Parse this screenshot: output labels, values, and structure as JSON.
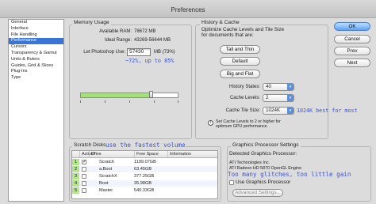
{
  "window": {
    "title": "Preferences"
  },
  "sidebar": {
    "items": [
      {
        "label": "General"
      },
      {
        "label": "Interface"
      },
      {
        "label": "File Handling"
      },
      {
        "label": "Performance"
      },
      {
        "label": "Cursors"
      },
      {
        "label": "Transparency & Gamut"
      },
      {
        "label": "Units & Rulers"
      },
      {
        "label": "Guides, Grid & Slices"
      },
      {
        "label": "Plug-Ins"
      },
      {
        "label": "Type"
      }
    ],
    "selected": "Performance"
  },
  "memory": {
    "title": "Memory Usage",
    "available_label": "Available RAM:",
    "available_value": "78672 MB",
    "ideal_label": "Ideal Range:",
    "ideal_value": "43269-56644 MB",
    "let_label": "Let Photoshop Use:",
    "let_value": "57430",
    "let_unit": "MB (73%)",
    "slider_level": 0.73,
    "annotation": "~72%, up to 85%"
  },
  "history": {
    "title": "History & Cache",
    "desc": "Optimize Cache Levels and Tile Size for documents that are:",
    "buttons": [
      "Tall and Thin",
      "Default",
      "Big and Flat"
    ],
    "states_label": "History States:",
    "states_value": "40",
    "levels_label": "Cache Levels:",
    "levels_value": "2",
    "tile_label": "Cache Tile Size:",
    "tile_value": "1024K",
    "tile_annotation": "1024K best for most",
    "info": "Set Cache Levels to 2 or higher for optimum GPU performance."
  },
  "actions": {
    "ok": "OK",
    "cancel": "Cancel",
    "prev": "Prev",
    "next": "Next"
  },
  "scratch": {
    "title": "Scratch Disks",
    "annotation": "use the fastest volume",
    "columns": [
      "Active?",
      "Drive",
      "Free Space",
      "Information"
    ],
    "rows": [
      {
        "num": "1",
        "active": true,
        "drive": "Scratch",
        "free": "1199.07GB"
      },
      {
        "num": "2",
        "active": false,
        "drive": "a.Boot",
        "free": "63.45GB"
      },
      {
        "num": "3",
        "active": false,
        "drive": "ScratchX",
        "free": "377.25GB"
      },
      {
        "num": "4",
        "active": false,
        "drive": "Boot",
        "free": "35.98GB"
      },
      {
        "num": "5",
        "active": false,
        "drive": "Master",
        "free": "540.33GB"
      }
    ]
  },
  "gpu": {
    "title": "Graphics Processor Settings",
    "detected_label": "Detected Graphics Processor:",
    "line1": "ATI Technologies Inc.",
    "line2": "ATI Radeon HD 5870 OpenGL Engine",
    "annotation": "Too many glitches, too little gain",
    "use_label": "Use Graphics Processor",
    "use_checked": false,
    "advanced_label": "Advanced Settings..."
  }
}
